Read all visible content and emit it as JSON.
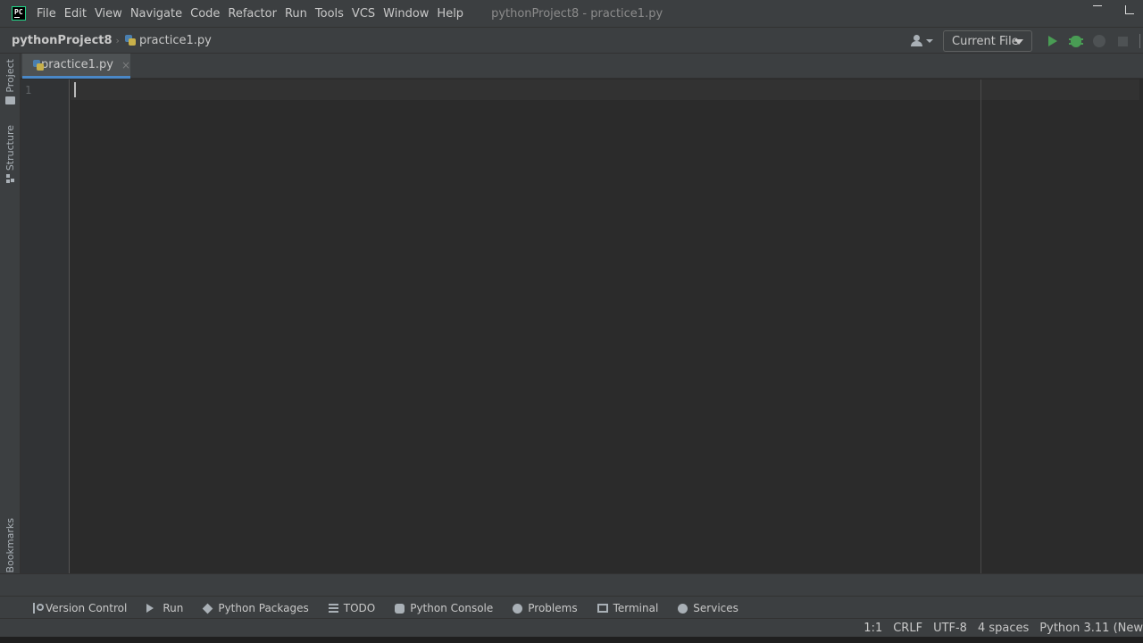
{
  "menubar": {
    "items": [
      "File",
      "Edit",
      "View",
      "Navigate",
      "Code",
      "Refactor",
      "Run",
      "Tools",
      "VCS",
      "Window",
      "Help"
    ],
    "window_title": "pythonProject8 - practice1.py",
    "logo_text": "PC"
  },
  "navbar": {
    "project": "pythonProject8",
    "file": "practice1.py",
    "run_config": "Current File"
  },
  "left_stripe": {
    "project": "Project",
    "structure": "Structure",
    "bookmarks": "Bookmarks"
  },
  "editor": {
    "tab_label": "practice1.py",
    "tab_close": "×",
    "line_numbers": [
      "1"
    ],
    "content": ""
  },
  "tool_windows": [
    "Version Control",
    "Run",
    "Python Packages",
    "TODO",
    "Python Console",
    "Problems",
    "Terminal",
    "Services"
  ],
  "statusbar": {
    "position": "1:1",
    "line_sep": "CRLF",
    "encoding": "UTF-8",
    "indent": "4 spaces",
    "interpreter": "Python 3.11 (New"
  },
  "colors": {
    "background": "#2b2b2b",
    "chrome": "#3c3f41",
    "accent_tab": "#4a88c7",
    "run_green": "#499c54"
  }
}
